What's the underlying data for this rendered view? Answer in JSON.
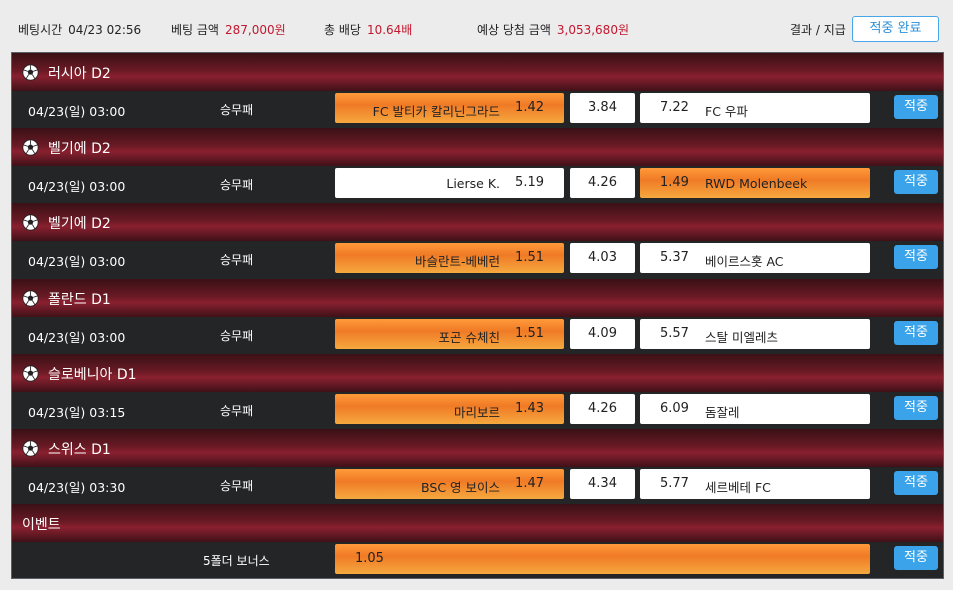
{
  "summary": {
    "bet_time_label": "베팅시간",
    "bet_time_value": "04/23 02:56",
    "bet_amount_label": "베팅 금액",
    "bet_amount_value": "287,000원",
    "total_odds_label": "총 배당",
    "total_odds_value": "10.64배",
    "expected_win_label": "예상 당첨 금액",
    "expected_win_value": "3,053,680원",
    "result_label": "결과 / 지급",
    "result_button": "적중 완료"
  },
  "colors": {
    "accent_red": "#c0182f",
    "hit_blue": "#3aa3ea",
    "selected_orange": "#f07a26",
    "league_band": "#6a1a24"
  },
  "groups": [
    {
      "league": "러시아 D2",
      "icon": "soccer-ball-icon",
      "time": "04/23(일)  03:00",
      "bet_type": "승무패",
      "home_team": "FC 발티카 칼리닌그라드",
      "home_odds": "1.42",
      "draw_odds": "3.84",
      "away_odds": "7.22",
      "away_team": "FC 우파",
      "selected": "home",
      "status": "적중"
    },
    {
      "league": "벨기에 D2",
      "icon": "soccer-ball-icon",
      "time": "04/23(일)  03:00",
      "bet_type": "승무패",
      "home_team": "Lierse K.",
      "home_odds": "5.19",
      "draw_odds": "4.26",
      "away_odds": "1.49",
      "away_team": "RWD Molenbeek",
      "selected": "away",
      "status": "적중"
    },
    {
      "league": "벨기에 D2",
      "icon": "soccer-ball-icon",
      "time": "04/23(일)  03:00",
      "bet_type": "승무패",
      "home_team": "바슬란트-베베런",
      "home_odds": "1.51",
      "draw_odds": "4.03",
      "away_odds": "5.37",
      "away_team": "베이르스홋 AC",
      "selected": "home",
      "status": "적중"
    },
    {
      "league": "폴란드 D1",
      "icon": "soccer-ball-icon",
      "time": "04/23(일)  03:00",
      "bet_type": "승무패",
      "home_team": "포곤 슈체친",
      "home_odds": "1.51",
      "draw_odds": "4.09",
      "away_odds": "5.57",
      "away_team": "스탈 미엘레츠",
      "selected": "home",
      "status": "적중"
    },
    {
      "league": "슬로베니아 D1",
      "icon": "soccer-ball-icon",
      "time": "04/23(일)  03:15",
      "bet_type": "승무패",
      "home_team": "마리보르",
      "home_odds": "1.43",
      "draw_odds": "4.26",
      "away_odds": "6.09",
      "away_team": "돔잘레",
      "selected": "home",
      "status": "적중"
    },
    {
      "league": "스위스 D1",
      "icon": "soccer-ball-icon",
      "time": "04/23(일)  03:30",
      "bet_type": "승무패",
      "home_team": "BSC 영 보이스",
      "home_odds": "1.47",
      "draw_odds": "4.34",
      "away_odds": "5.77",
      "away_team": "세르베테 FC",
      "selected": "home",
      "status": "적중"
    }
  ],
  "event": {
    "header": "이벤트",
    "label": "5폴더 보너스",
    "odds": "1.05",
    "status": "적중"
  }
}
